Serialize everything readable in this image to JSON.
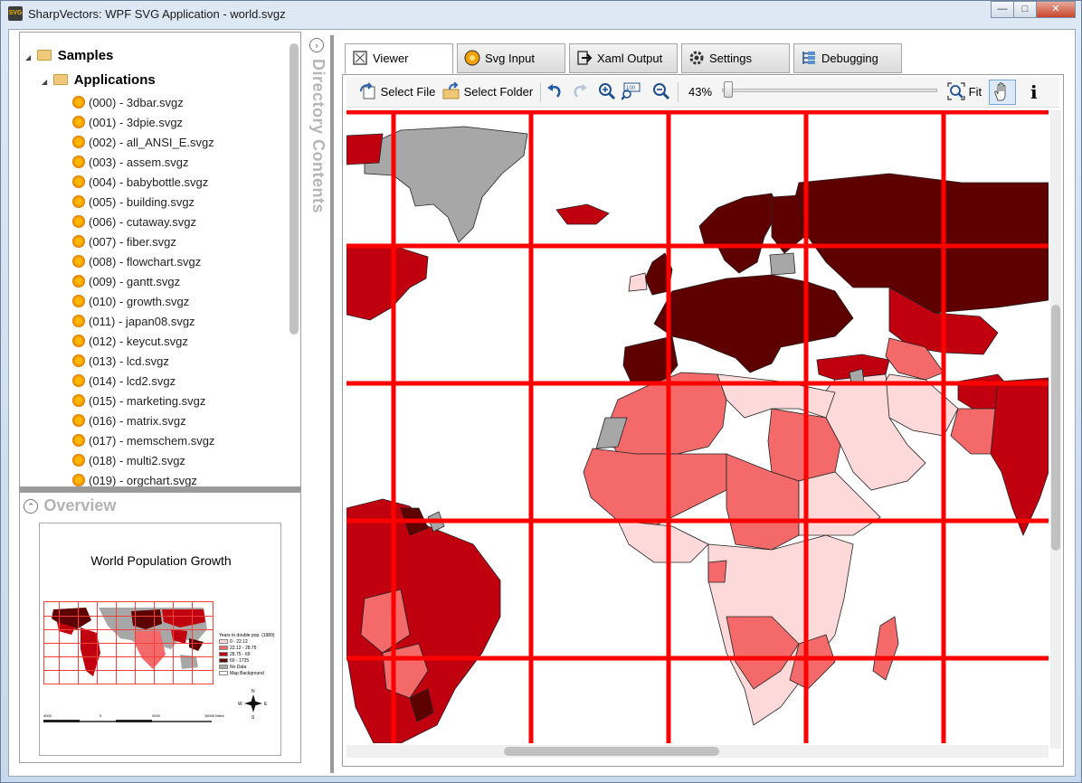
{
  "window": {
    "title": "SharpVectors: WPF SVG Application - world.svgz",
    "icon_text": "SVG"
  },
  "tree": {
    "root_label": "Samples",
    "folder_label": "Applications",
    "files": [
      "(000) - 3dbar.svgz",
      "(001) - 3dpie.svgz",
      "(002) - all_ANSI_E.svgz",
      "(003) - assem.svgz",
      "(004) - babybottle.svgz",
      "(005) - building.svgz",
      "(006) - cutaway.svgz",
      "(007) - fiber.svgz",
      "(008) - flowchart.svgz",
      "(009) - gantt.svgz",
      "(010) - growth.svgz",
      "(011) - japan08.svgz",
      "(012) - keycut.svgz",
      "(013) - lcd.svgz",
      "(014) - lcd2.svgz",
      "(015) - marketing.svgz",
      "(016) - matrix.svgz",
      "(017) - memschem.svgz",
      "(018) - multi2.svgz",
      "(019) - orgchart.svgz"
    ]
  },
  "overview": {
    "title": "Overview",
    "doc_title": "World Population Growth",
    "legend_title": "Years to double pop. (1989)",
    "legend": [
      {
        "label": "0 - 22.12",
        "color": "#fdd9d9"
      },
      {
        "label": "22.12 - 28.75",
        "color": "#f46a6a"
      },
      {
        "label": "28.75 - 69",
        "color": "#c0000f"
      },
      {
        "label": "69 - 1725",
        "color": "#5e0000"
      },
      {
        "label": "No Data",
        "color": "#a7a7a7"
      },
      {
        "label": "Map Background",
        "color": "#ffffff"
      }
    ],
    "scale_labels": [
      "4000",
      "0",
      "4000",
      "16000 Miles"
    ],
    "compass": {
      "n": "N",
      "s": "S",
      "e": "E",
      "w": "W"
    }
  },
  "side_label": "Directory Contents",
  "tabs": [
    {
      "label": "Viewer",
      "icon": "viewer-icon"
    },
    {
      "label": "Svg Input",
      "icon": "svg-file-icon"
    },
    {
      "label": "Xaml Output",
      "icon": "export-icon"
    },
    {
      "label": "Settings",
      "icon": "gear-icon"
    },
    {
      "label": "Debugging",
      "icon": "debug-icon"
    }
  ],
  "toolbar": {
    "select_file": "Select File",
    "select_folder": "Select Folder",
    "zoom_level": "43%",
    "fit": "Fit",
    "info": "i",
    "zoom_100": "100"
  },
  "map_colors": {
    "lightest": "#fdd9d9",
    "light": "#f46a6a",
    "medium": "#c0000f",
    "dark": "#5e0000",
    "nodata": "#a7a7a7",
    "grid": "#ff0000"
  }
}
